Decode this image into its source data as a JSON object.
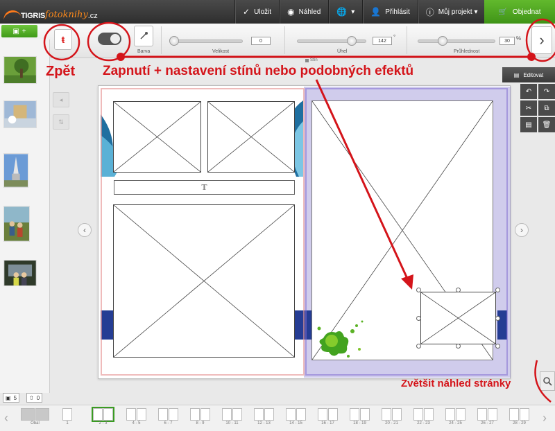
{
  "brand": {
    "name_a": "TIGRIS",
    "name_b": "fotoknihy",
    "name_c": ".cz"
  },
  "topnav": [
    {
      "icon": "✓",
      "label": "Uložit"
    },
    {
      "icon": "◉",
      "label": "Náhled"
    },
    {
      "icon": "🌐",
      "label": "▾"
    },
    {
      "icon": "👤",
      "label": "Přihlásit"
    },
    {
      "icon": "ⓘ",
      "label": "Můj projekt ▾"
    }
  ],
  "order": {
    "icon": "🛒",
    "label": "Objednat"
  },
  "toolbar": {
    "add_label": "+",
    "back_glyph": "ŧ",
    "color_label": "Barva",
    "size": {
      "label": "Velikost",
      "value": "0",
      "fraction": 0.0
    },
    "angle": {
      "label": "Úhel",
      "value": "142",
      "unit": "°",
      "fraction": 0.82
    },
    "opacity": {
      "label": "Průhlednost",
      "value": "30",
      "unit": "%",
      "fraction": 0.3
    },
    "shadow_label": "Stín",
    "next_glyph": "›"
  },
  "edit_panel": {
    "title": "Editovat",
    "icons": [
      "↶",
      "↷",
      "✂",
      "⧉",
      "▤",
      "🗑"
    ]
  },
  "left_panel": {
    "photo_count": "5",
    "upload_count": "0"
  },
  "text_placeholder": "T",
  "pages": [
    {
      "label": "Obal"
    },
    {
      "label": "1"
    },
    {
      "label": "2 - 3"
    },
    {
      "label": "4 - 5"
    },
    {
      "label": "6 - 7"
    },
    {
      "label": "8 - 9"
    },
    {
      "label": "10 - 11"
    },
    {
      "label": "12 - 13"
    },
    {
      "label": "14 - 15"
    },
    {
      "label": "16 - 17"
    },
    {
      "label": "18 - 19"
    },
    {
      "label": "20 - 21"
    },
    {
      "label": "22 - 23"
    },
    {
      "label": "24 - 25"
    },
    {
      "label": "26 - 27"
    },
    {
      "label": "28 - 29"
    }
  ],
  "annotations": {
    "back": "Zpět",
    "shadow": "Zapnutí + nastavení stínů nebo podobných efektů",
    "zoom": "Zvětšit náhled stránky"
  },
  "colors": {
    "accent_green": "#4fa823",
    "annotation_red": "#d4141a",
    "stripe_blue": "#253d94"
  }
}
